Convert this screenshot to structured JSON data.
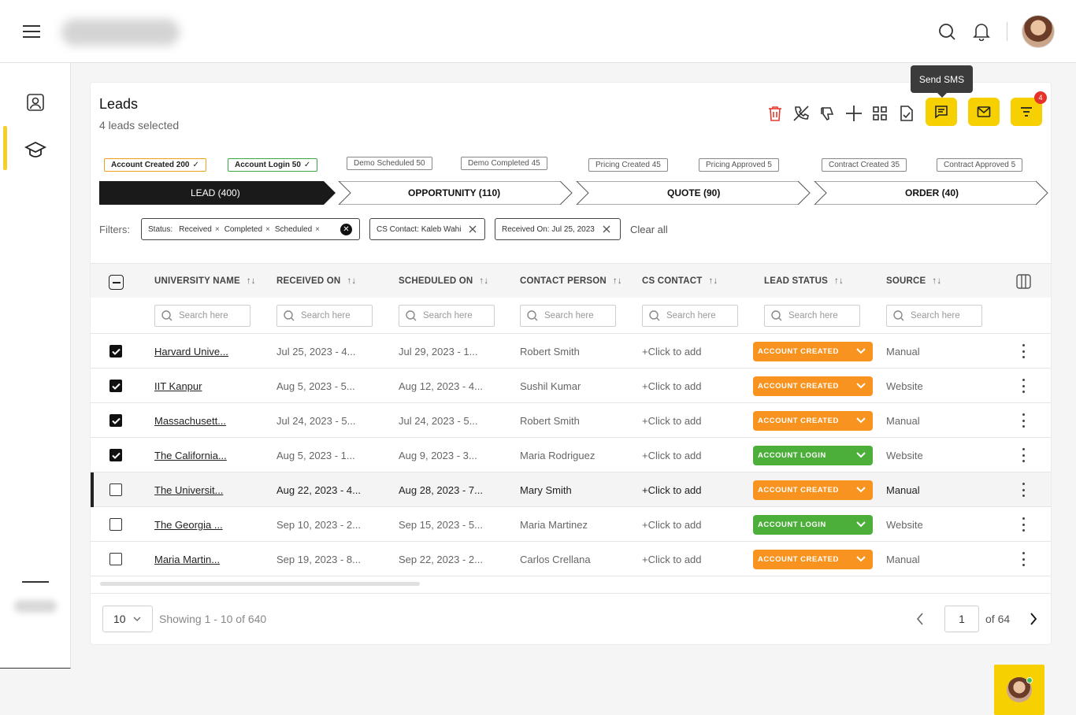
{
  "header": {
    "search_icon": "search-icon",
    "bell_icon": "bell-icon"
  },
  "card": {
    "title": "Leads",
    "subtitle": "4 leads selected",
    "tooltip": "Send SMS",
    "filter_badge": "4"
  },
  "stage_chips": [
    {
      "label": "Account Created 200",
      "check": "✓"
    },
    {
      "label": "Account Login 50",
      "check": "✓"
    },
    {
      "label": "Demo Scheduled 50"
    },
    {
      "label": "Demo Completed 45"
    },
    {
      "label": "Pricing Created 45"
    },
    {
      "label": "Pricing Approved 5"
    },
    {
      "label": "Contract Created 35"
    },
    {
      "label": "Contract Approved 5"
    }
  ],
  "pipeline": [
    {
      "label": "LEAD  (400)",
      "active": true
    },
    {
      "label": "OPPORTUNITY  (110)"
    },
    {
      "label": "QUOTE (90)"
    },
    {
      "label": "ORDER (40)"
    }
  ],
  "filters": {
    "label": "Filters:",
    "status_label": "Status:",
    "status_values": [
      "Received",
      "Completed",
      "Scheduled"
    ],
    "cs_contact": "CS Contact: Kaleb Wahi",
    "received_on": "Received On: Jul 25, 2023",
    "clear_all": "Clear all"
  },
  "columns": [
    "UNIVERSITY NAME",
    "RECEIVED ON",
    "SCHEDULED ON",
    "CONTACT PERSON",
    "CS CONTACT",
    "LEAD STATUS",
    "SOURCE"
  ],
  "search_placeholder": "Search here",
  "rows": [
    {
      "name": "Harvard Unive...",
      "received": "Jul 25, 2023 - 4...",
      "scheduled": "Jul 29, 2023 - 1...",
      "contact": "Robert Smith",
      "cs": "+Click to add",
      "status": "ACCOUNT CREATED",
      "source": "Manual",
      "checked": true
    },
    {
      "name": "IIT Kanpur",
      "received": "Aug 5, 2023 - 5...",
      "scheduled": "Aug 12, 2023 - 4...",
      "contact": "Sushil Kumar",
      "cs": "+Click to add",
      "status": "ACCOUNT CREATED",
      "source": "Website",
      "checked": true
    },
    {
      "name": "Massachusett...",
      "received": "Jul 24, 2023 - 5...",
      "scheduled": "Jul 24, 2023 - 5...",
      "contact": "Robert Smith",
      "cs": "+Click to add",
      "status": "ACCOUNT CREATED",
      "source": "Manual",
      "checked": true
    },
    {
      "name": "The California...",
      "received": "Aug 5, 2023 - 1...",
      "scheduled": "Aug 9, 2023 - 3...",
      "contact": "Maria Rodriguez",
      "cs": "+Click to add",
      "status": "ACCOUNT LOGIN",
      "source": "Website",
      "checked": true
    },
    {
      "name": "The Universit...",
      "received": "Aug 22, 2023 - 4...",
      "scheduled": "Aug 28, 2023 - 7...",
      "contact": "Mary Smith",
      "cs": "+Click to add",
      "status": "ACCOUNT CREATED",
      "source": "Manual",
      "checked": false
    },
    {
      "name": "The Georgia ...",
      "received": "Sep 10, 2023 - 2...",
      "scheduled": "Sep 15, 2023 - 5...",
      "contact": "Maria Martinez",
      "cs": "+Click to add",
      "status": "ACCOUNT LOGIN",
      "source": "Website",
      "checked": false
    },
    {
      "name": "Maria Martin...",
      "received": "Sep 19, 2023 - 8...",
      "scheduled": "Sep 22, 2023 - 2...",
      "contact": "Carlos Crellana",
      "cs": "+Click to add",
      "status": "ACCOUNT CREATED",
      "source": "Manual",
      "checked": false
    }
  ],
  "status_colors": {
    "ACCOUNT CREATED": "#f7931e",
    "ACCOUNT LOGIN": "#4caf3a"
  },
  "pagination": {
    "page_size": "10",
    "showing": "Showing 1 - 10 of 640",
    "current_page": "1",
    "of_pages": "of 64"
  }
}
